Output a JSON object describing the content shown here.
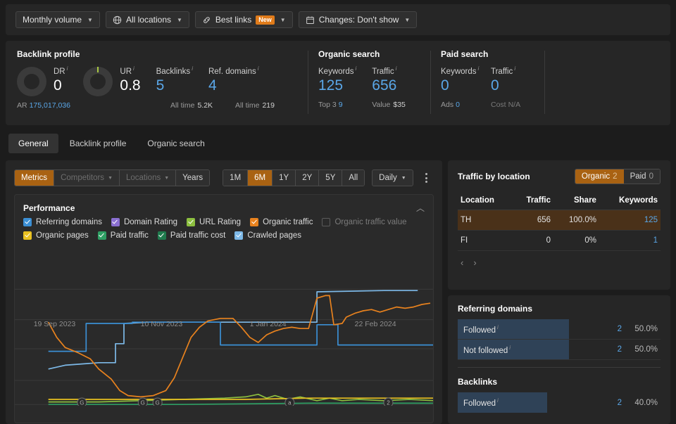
{
  "toolbar": {
    "buttons": [
      {
        "label": "Monthly volume",
        "icon": "",
        "caret": true,
        "badge": null
      },
      {
        "label": "All locations",
        "icon": "globe-icon",
        "caret": true,
        "badge": null
      },
      {
        "label": "Best links",
        "icon": "link-icon",
        "caret": true,
        "badge": "New"
      },
      {
        "label": "Changes: Don't show",
        "icon": "calendar-icon",
        "caret": true,
        "badge": null
      }
    ]
  },
  "metrics": {
    "backlink_profile": {
      "title": "Backlink profile",
      "dr": {
        "label": "DR",
        "value": "0",
        "sub_label": "AR",
        "sub_value": "175,017,036"
      },
      "ur": {
        "label": "UR",
        "value": "0.8"
      },
      "backlinks": {
        "label": "Backlinks",
        "value": "5",
        "sub_label": "All time",
        "sub_value": "5.2K"
      },
      "ref_domains": {
        "label": "Ref. domains",
        "value": "4",
        "sub_label": "All time",
        "sub_value": "219"
      }
    },
    "organic_search": {
      "title": "Organic search",
      "keywords": {
        "label": "Keywords",
        "value": "125",
        "sub_label": "Top 3",
        "sub_value": "9"
      },
      "traffic": {
        "label": "Traffic",
        "value": "656",
        "sub_label": "Value",
        "sub_value": "$35"
      }
    },
    "paid_search": {
      "title": "Paid search",
      "keywords": {
        "label": "Keywords",
        "value": "0",
        "sub_label": "Ads",
        "sub_value": "0"
      },
      "traffic": {
        "label": "Traffic",
        "value": "0",
        "sub_label": "Cost",
        "sub_value": "N/A"
      }
    }
  },
  "tabs": [
    {
      "label": "General",
      "active": true
    },
    {
      "label": "Backlink profile",
      "active": false
    },
    {
      "label": "Organic search",
      "active": false
    }
  ],
  "controls": {
    "view_seg": [
      {
        "label": "Metrics",
        "state": "on",
        "caret": false
      },
      {
        "label": "Competitors",
        "state": "dis",
        "caret": true
      },
      {
        "label": "Locations",
        "state": "dis",
        "caret": true
      },
      {
        "label": "Years",
        "state": "normal",
        "caret": false
      }
    ],
    "range_seg": [
      {
        "label": "1M",
        "state": "normal"
      },
      {
        "label": "6M",
        "state": "on"
      },
      {
        "label": "1Y",
        "state": "normal"
      },
      {
        "label": "2Y",
        "state": "normal"
      },
      {
        "label": "5Y",
        "state": "normal"
      },
      {
        "label": "All",
        "state": "normal"
      }
    ],
    "granularity": "Daily",
    "kebab": "more-options"
  },
  "performance": {
    "title": "Performance",
    "legend_row1": [
      {
        "label": "Referring domains",
        "color": "#3b8fd4",
        "checked": true
      },
      {
        "label": "Domain Rating",
        "color": "#8a6fd1",
        "checked": true
      },
      {
        "label": "URL Rating",
        "color": "#8cbf3f",
        "checked": true
      },
      {
        "label": "Organic traffic",
        "color": "#e8821e",
        "checked": true
      },
      {
        "label": "Organic traffic value",
        "color": "#5a5a5a",
        "checked": false
      }
    ],
    "legend_row2": [
      {
        "label": "Organic pages",
        "color": "#e8c020",
        "checked": true
      },
      {
        "label": "Paid traffic",
        "color": "#2e9e63",
        "checked": true
      },
      {
        "label": "Paid traffic cost",
        "color": "#1f7a4d",
        "checked": true
      },
      {
        "label": "Crawled pages",
        "color": "#7db9e8",
        "checked": true
      }
    ]
  },
  "chart_data": {
    "type": "line",
    "title": "Performance",
    "xlabel": "",
    "ylabel": "",
    "grid": true,
    "legend_position": "top",
    "x_tick_labels": [
      "19 Sep 2023",
      "10 Nov 2023",
      "1 Jan 2024",
      "22 Feb 2024"
    ],
    "x_tick_positions_pct": [
      7.5,
      33.0,
      59.0,
      84.0
    ],
    "annotations": [
      {
        "label": "G",
        "x_pct": 16.0
      },
      {
        "label": "G",
        "x_pct": 30.5
      },
      {
        "label": "G",
        "x_pct": 34.0
      },
      {
        "label": "a",
        "x_pct": 65.5
      },
      {
        "label": "2",
        "x_pct": 89.0
      }
    ],
    "series": [
      {
        "name": "Referring domains",
        "color": "#3b8fd4",
        "points": [
          [
            8,
            57
          ],
          [
            17,
            57
          ],
          [
            17,
            35
          ],
          [
            28,
            35
          ],
          [
            28,
            34
          ],
          [
            49,
            34
          ],
          [
            49,
            52
          ],
          [
            72,
            52
          ],
          [
            72,
            36
          ],
          [
            77,
            36
          ],
          [
            77,
            52
          ],
          [
            100,
            52
          ]
        ]
      },
      {
        "name": "Crawled pages",
        "color": "#7db9e8",
        "points": [
          [
            8,
            71
          ],
          [
            12,
            68
          ],
          [
            20,
            66
          ],
          [
            24,
            66
          ],
          [
            24,
            51
          ],
          [
            26,
            51
          ],
          [
            26,
            35
          ],
          [
            32,
            34
          ],
          [
            60,
            34
          ],
          [
            72,
            34
          ],
          [
            72,
            10
          ],
          [
            88,
            9
          ],
          [
            96,
            9
          ]
        ]
      },
      {
        "name": "Organic traffic",
        "color": "#e8821e",
        "points": [
          [
            8,
            34
          ],
          [
            10,
            46
          ],
          [
            12,
            54
          ],
          [
            15,
            58
          ],
          [
            18,
            63
          ],
          [
            20,
            71
          ],
          [
            23,
            79
          ],
          [
            25,
            88
          ],
          [
            27,
            92
          ],
          [
            30,
            93
          ],
          [
            33,
            92
          ],
          [
            36,
            88
          ],
          [
            38,
            78
          ],
          [
            40,
            62
          ],
          [
            42,
            46
          ],
          [
            44,
            38
          ],
          [
            46,
            33
          ],
          [
            49,
            31
          ],
          [
            52,
            31
          ],
          [
            54,
            38
          ],
          [
            56,
            46
          ],
          [
            58,
            50
          ],
          [
            60,
            44
          ],
          [
            62,
            41
          ],
          [
            64,
            39
          ],
          [
            66,
            38
          ],
          [
            68,
            39
          ],
          [
            70,
            39
          ],
          [
            72,
            15
          ],
          [
            74,
            13
          ],
          [
            75,
            13
          ],
          [
            76,
            36
          ],
          [
            78,
            35
          ],
          [
            79,
            30
          ],
          [
            81,
            27
          ],
          [
            83,
            25
          ],
          [
            85,
            24
          ],
          [
            87,
            26
          ],
          [
            89,
            24
          ],
          [
            91,
            22
          ],
          [
            93,
            23
          ],
          [
            95,
            22
          ],
          [
            97,
            20
          ],
          [
            99,
            19
          ]
        ]
      },
      {
        "name": "Organic pages",
        "color": "#e8c020",
        "points": [
          [
            8,
            95
          ],
          [
            30,
            95
          ],
          [
            40,
            95
          ],
          [
            55,
            95
          ],
          [
            70,
            94
          ],
          [
            80,
            94
          ],
          [
            90,
            94
          ],
          [
            100,
            94
          ]
        ]
      },
      {
        "name": "URL Rating",
        "color": "#8cbf3f",
        "points": [
          [
            8,
            97
          ],
          [
            20,
            97
          ],
          [
            30,
            96
          ],
          [
            40,
            95
          ],
          [
            50,
            94
          ],
          [
            55,
            93
          ],
          [
            58,
            91
          ],
          [
            60,
            94
          ],
          [
            62,
            92
          ],
          [
            65,
            95
          ],
          [
            68,
            93
          ],
          [
            72,
            96
          ],
          [
            75,
            94
          ],
          [
            78,
            96
          ],
          [
            82,
            95
          ],
          [
            88,
            96
          ],
          [
            94,
            95
          ],
          [
            100,
            96
          ]
        ]
      },
      {
        "name": "Paid traffic",
        "color": "#2e9e63",
        "points": [
          [
            8,
            99
          ],
          [
            40,
            99
          ],
          [
            70,
            98
          ],
          [
            100,
            98
          ]
        ]
      }
    ]
  },
  "traffic_by_location": {
    "title": "Traffic by location",
    "toggle": [
      {
        "label": "Organic",
        "count": "2",
        "active": true
      },
      {
        "label": "Paid",
        "count": "0",
        "active": false
      }
    ],
    "columns": [
      "Location",
      "Traffic",
      "Share",
      "Keywords"
    ],
    "rows": [
      {
        "location": "TH",
        "traffic": "656",
        "share": "100.0%",
        "keywords": "125",
        "highlight": true
      },
      {
        "location": "FI",
        "traffic": "0",
        "share": "0%",
        "keywords": "1",
        "highlight": false
      }
    ],
    "pager": {
      "prev": "‹",
      "next": "›"
    }
  },
  "referring_domains": {
    "title": "Referring domains",
    "rows": [
      {
        "label": "Followed",
        "count": "2",
        "percent": "50.0%",
        "bar_pct": 55
      },
      {
        "label": "Not followed",
        "count": "2",
        "percent": "50.0%",
        "bar_pct": 55
      }
    ]
  },
  "backlinks_panel": {
    "title": "Backlinks",
    "rows": [
      {
        "label": "Followed",
        "count": "2",
        "percent": "40.0%",
        "bar_pct": 44
      }
    ]
  }
}
